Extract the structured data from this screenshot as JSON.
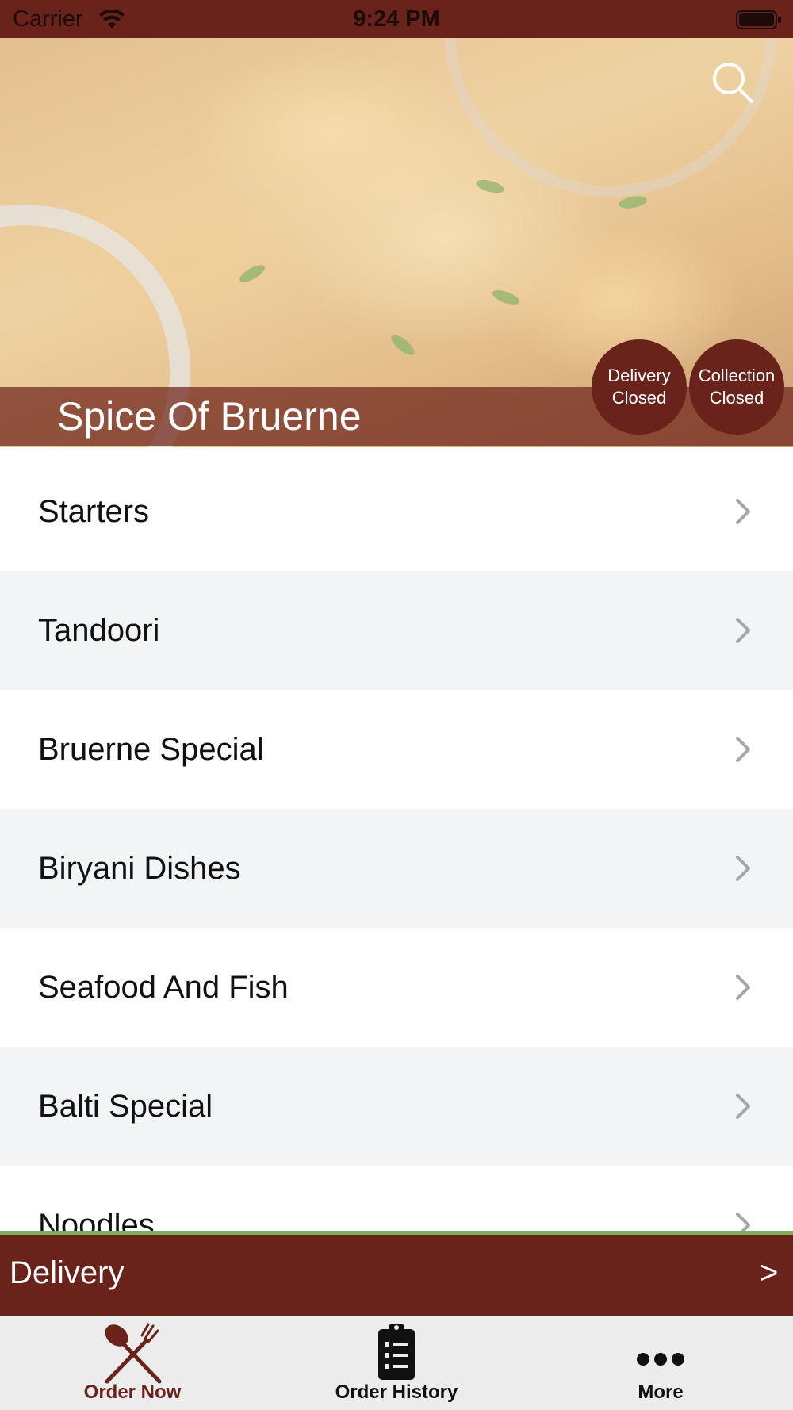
{
  "status_bar": {
    "carrier": "Carrier",
    "time": "9:24 PM",
    "wifi_icon": "wifi-icon",
    "battery_icon": "battery-icon"
  },
  "hero": {
    "restaurant_name": "Spice Of Bruerne",
    "search_icon": "search-icon",
    "delivery_status": {
      "line1": "Delivery",
      "line2": "Closed"
    },
    "collection_status": {
      "line1": "Collection",
      "line2": "Closed"
    }
  },
  "categories": [
    {
      "label": "Starters"
    },
    {
      "label": "Tandoori"
    },
    {
      "label": "Bruerne Special"
    },
    {
      "label": "Biryani Dishes"
    },
    {
      "label": "Seafood And Fish"
    },
    {
      "label": "Balti Special"
    },
    {
      "label": "Noodles"
    }
  ],
  "delivery_bar": {
    "label": "Delivery",
    "arrow": ">"
  },
  "tab_bar": {
    "order_now": "Order Now",
    "order_history": "Order History",
    "more": "More"
  },
  "colors": {
    "brand": "#6a231b",
    "accent_green": "#7ab05c",
    "row_alt": "#f3f4f6",
    "tab_bg": "#ececec"
  }
}
